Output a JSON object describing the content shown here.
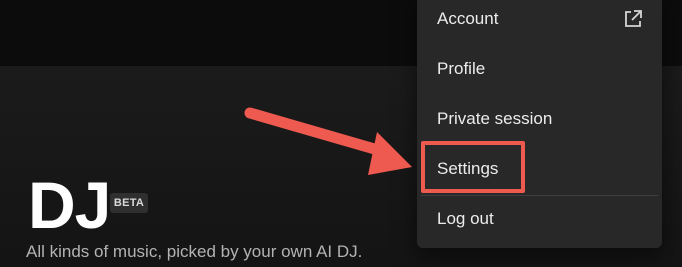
{
  "hero": {
    "title": "DJ",
    "badge": "BETA",
    "subtitle": "All kinds of music, picked by your own AI DJ."
  },
  "menu": {
    "items": [
      {
        "label": "Account",
        "icon": "external-link-icon"
      },
      {
        "label": "Profile"
      },
      {
        "label": "Private session"
      },
      {
        "label": "Settings"
      },
      {
        "label": "Log out"
      }
    ]
  },
  "annotation": {
    "color": "#ef5a50",
    "target": "Settings"
  }
}
